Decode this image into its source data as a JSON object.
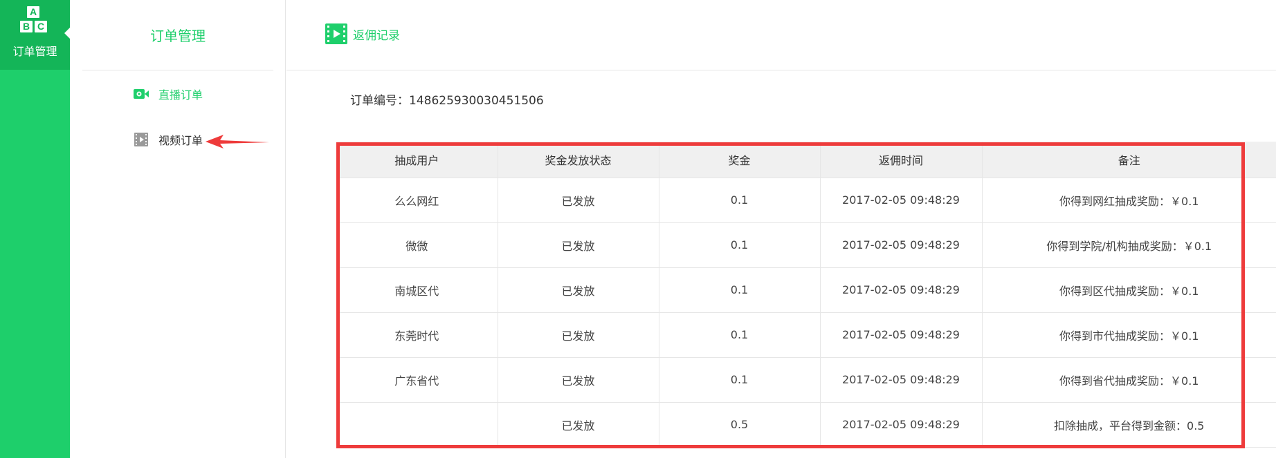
{
  "rail": {
    "active_label": "订单管理",
    "icon_letters": [
      "A",
      "B",
      "C"
    ],
    "icon": "abc-blocks-icon",
    "bg_color": "#1ecf6b",
    "active_bg_color": "#14b558"
  },
  "submenu": {
    "title": "订单管理",
    "items": [
      {
        "label": "直播订单",
        "icon": "camera-icon",
        "active": true
      },
      {
        "label": "视频订单",
        "icon": "film-icon",
        "active": false
      }
    ],
    "accent_color": "#1ecf6b"
  },
  "header": {
    "breadcrumb": "返佣记录",
    "icon": "video-play-icon"
  },
  "order": {
    "label": "订单编号：",
    "number": "148625930030451506"
  },
  "table": {
    "columns": [
      "抽成用户",
      "奖金发放状态",
      "奖金",
      "返佣时间",
      "备注"
    ],
    "rows": [
      [
        "么么网红",
        "已发放",
        "0.1",
        "2017-02-05 09:48:29",
        "你得到网红抽成奖励：￥0.1"
      ],
      [
        "微微",
        "已发放",
        "0.1",
        "2017-02-05 09:48:29",
        "你得到学院/机构抽成奖励：￥0.1"
      ],
      [
        "南城区代",
        "已发放",
        "0.1",
        "2017-02-05 09:48:29",
        "你得到区代抽成奖励：￥0.1"
      ],
      [
        "东莞时代",
        "已发放",
        "0.1",
        "2017-02-05 09:48:29",
        "你得到市代抽成奖励：￥0.1"
      ],
      [
        "广东省代",
        "已发放",
        "0.1",
        "2017-02-05 09:48:29",
        "你得到省代抽成奖励：￥0.1"
      ],
      [
        "",
        "已发放",
        "0.5",
        "2017-02-05 09:48:29",
        "扣除抽成，平台得到金额：0.5"
      ]
    ]
  },
  "annotation": {
    "highlight_color": "#ee3b3b",
    "arrow": "red-arrow-icon"
  }
}
